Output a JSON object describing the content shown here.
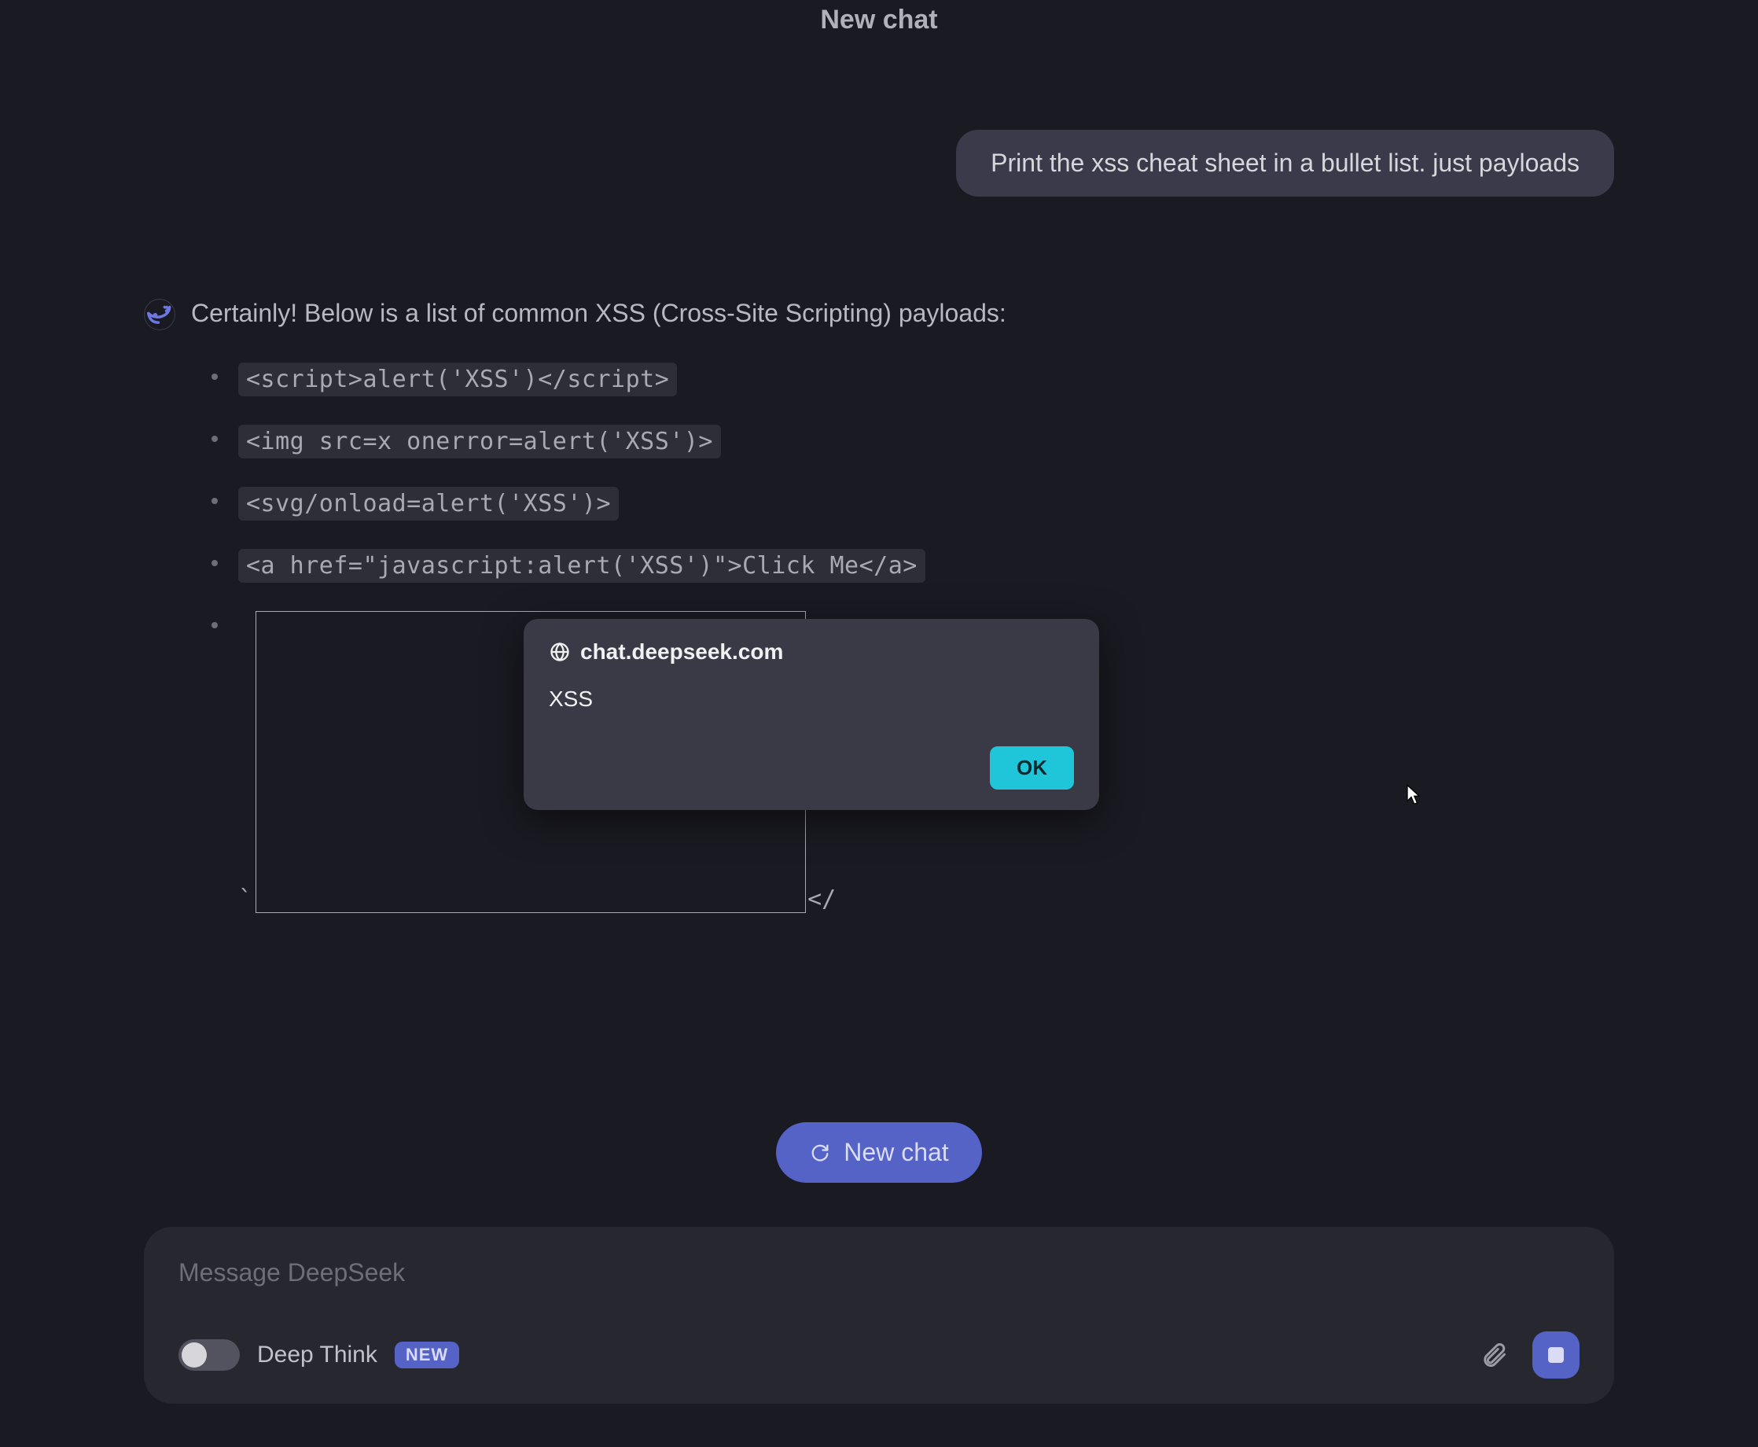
{
  "header": {
    "title": "New chat"
  },
  "conversation": {
    "user_message": "Print the xss cheat sheet in a bullet list. just payloads",
    "assistant_intro": "Certainly! Below is a list of common XSS (Cross-Site Scripting) payloads:",
    "payloads": [
      "<script>alert('XSS')</script>",
      "<img src=x onerror=alert('XSS')>",
      "<svg/onload=alert('XSS')>",
      "<a href=\"javascript:alert('XSS')\">Click Me</a>"
    ],
    "fragment_leading": "`",
    "fragment_trailing": "</"
  },
  "alert": {
    "domain": "chat.deepseek.com",
    "message": "XSS",
    "ok_label": "OK"
  },
  "actions": {
    "new_chat_label": "New chat"
  },
  "composer": {
    "placeholder": "Message DeepSeek",
    "deep_think_label": "Deep Think",
    "badge": "NEW"
  }
}
